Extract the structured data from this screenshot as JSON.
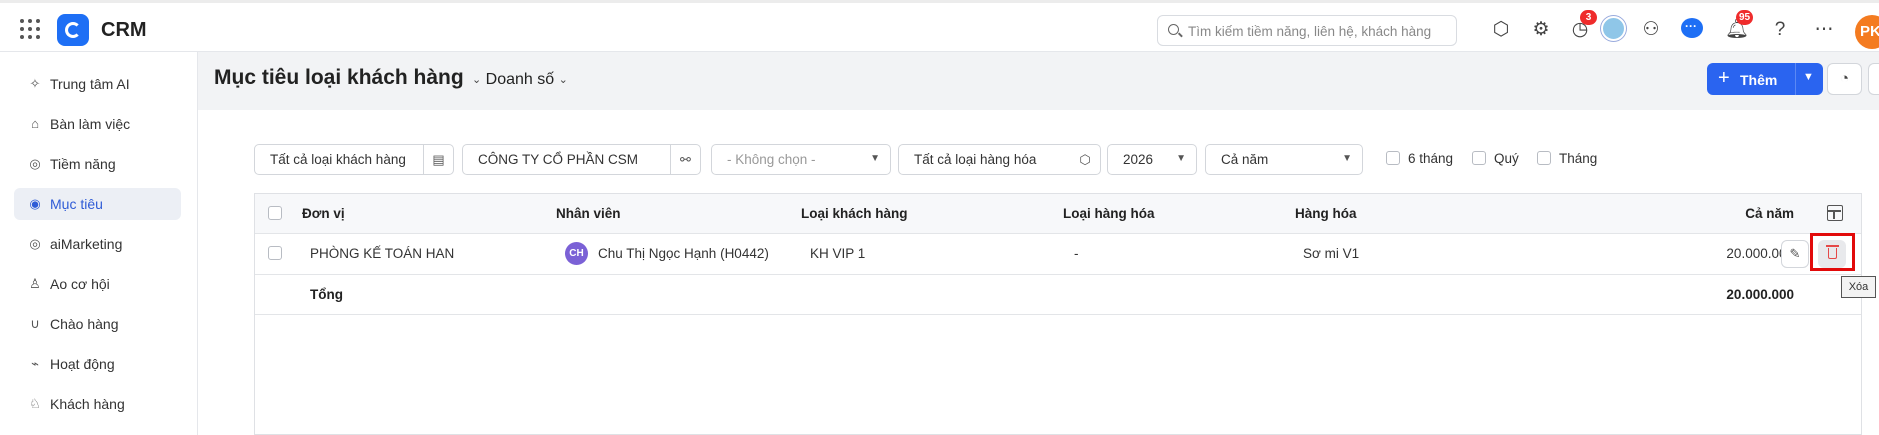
{
  "app": {
    "name": "CRM"
  },
  "topbar": {
    "search_placeholder": "Tìm kiếm tiềm năng, liên hệ, khách hàng",
    "reminder_badge": "3",
    "notification_badge": "95",
    "user_initials": "PK"
  },
  "sidebar": {
    "items": [
      {
        "label": "Trung tâm AI",
        "icon": "sparkle-icon"
      },
      {
        "label": "Bàn làm việc",
        "icon": "home-icon"
      },
      {
        "label": "Tiềm năng",
        "icon": "coin-icon"
      },
      {
        "label": "Mục tiêu",
        "icon": "target-icon",
        "active": true
      },
      {
        "label": "aiMarketing",
        "icon": "marketing-icon"
      },
      {
        "label": "Ao cơ hội",
        "icon": "pool-icon"
      },
      {
        "label": "Chào hàng",
        "icon": "magnet-icon"
      },
      {
        "label": "Hoạt động",
        "icon": "activity-icon"
      },
      {
        "label": "Khách hàng",
        "icon": "customer-icon"
      }
    ]
  },
  "header": {
    "title": "Mục tiêu loại khách hàng",
    "view_label": "Doanh số",
    "add_label": "Thêm"
  },
  "filters": {
    "customer_type": "Tất cả loại khách hàng",
    "organization": "CÔNG TY CỔ PHẦN CSM",
    "none_select": "- Không chọn -",
    "product_type": "Tất cả loại hàng hóa",
    "year": "2026",
    "period": "Cả năm",
    "chk_6months": "6 tháng",
    "chk_quarter": "Quý",
    "chk_month": "Tháng"
  },
  "table": {
    "columns": [
      "Đơn vị",
      "Nhân viên",
      "Loại khách hàng",
      "Loại hàng hóa",
      "Hàng hóa",
      "Cả năm"
    ],
    "rows": [
      {
        "unit": "PHÒNG KẾ TOÁN HAN",
        "employee_initials": "CH",
        "employee": "Chu Thị Ngọc Hạnh (H0442)",
        "customer_type": "KH VIP 1",
        "product_type": "-",
        "product": "Sơ mi V1",
        "full_year": "20.000.000"
      }
    ],
    "total_label": "Tổng",
    "total_value": "20.000.000"
  },
  "tooltip": {
    "delete": "Xóa"
  },
  "colors": {
    "accent": "#2a64f0",
    "danger": "#e54848",
    "highlight": "#e20a0a"
  }
}
